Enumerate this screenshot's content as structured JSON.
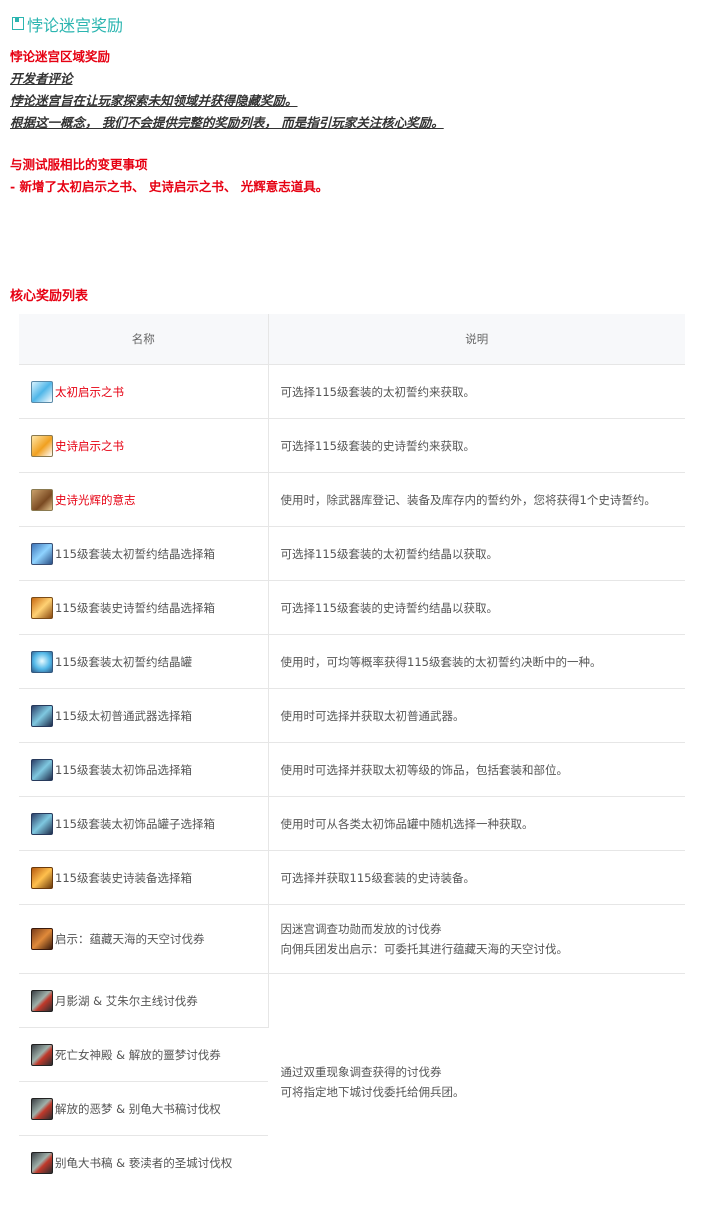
{
  "header": {
    "title": "悖论迷宫奖励"
  },
  "intro": {
    "zone_title": "悖论迷宫区域奖励",
    "dev_comment": "开发者评论",
    "line1": "悖论迷宫旨在让玩家探索未知领域并获得隐藏奖励。",
    "line2": "根据这一概念， 我们不会提供完整的奖励列表， 而是指引玩家关注核心奖励。",
    "changes_title": "与测试服相比的变更事项",
    "changes_line": "- 新增了太初启示之书、 史诗启示之书、 光辉意志道具。"
  },
  "section": {
    "title": "核心奖励列表"
  },
  "table": {
    "headers": [
      "名称",
      "说明"
    ],
    "rows": [
      {
        "name": "太初启示之书",
        "icon": "primeval-book-icon",
        "desc": "可选择115级套装的太初誓约来获取。",
        "red": true
      },
      {
        "name": "史诗启示之书",
        "icon": "epic-book-icon",
        "desc": "可选择115级套装的史诗誓约来获取。",
        "red": true
      },
      {
        "name": "史诗光辉的意志",
        "icon": "radiant-will-icon",
        "desc": "使用时，除武器库登记、装备及库存内的誓约外，您将获得1个史诗誓约。",
        "red": true
      },
      {
        "name": "115级套装太初誓约结晶选择箱",
        "icon": "primeval-crystal-box-icon",
        "desc": "可选择115级套装的太初誓约结晶以获取。",
        "red": false
      },
      {
        "name": "115级套装史诗誓约结晶选择箱",
        "icon": "epic-crystal-box-icon",
        "desc": "可选择115级套装的史诗誓约结晶以获取。",
        "red": false
      },
      {
        "name": "115级套装太初誓约结晶罐",
        "icon": "primeval-crystal-jar-icon",
        "desc": "使用时，可均等概率获得115级套装的太初誓约决断中的一种。",
        "red": false
      },
      {
        "name": "115级太初普通武器选择箱",
        "icon": "primeval-weapon-box-icon",
        "desc": "使用时可选择并获取太初普通武器。",
        "red": false
      },
      {
        "name": "115级套装太初饰品选择箱",
        "icon": "primeval-accessory-box-icon",
        "desc": "使用时可选择并获取太初等级的饰品，包括套装和部位。",
        "red": false
      },
      {
        "name": "115级套装太初饰品罐子选择箱",
        "icon": "primeval-accessory-jar-box-icon",
        "desc": "使用时可从各类太初饰品罐中随机选择一种获取。",
        "red": false
      },
      {
        "name": "115级套装史诗装备选择箱",
        "icon": "epic-equipment-box-icon",
        "desc": "可选择并获取115级套装的史诗装备。",
        "red": false
      }
    ],
    "skyhunt": {
      "name": "启示：蕴藏天海的天空讨伐券",
      "icon": "sky-raid-ticket-icon",
      "desc1": "因迷宫调查功勋而发放的讨伐券",
      "desc2": "向佣兵团发出启示：可委托其进行蕴藏天海的天空讨伐。"
    },
    "dungeon_group": {
      "names": [
        "月影湖 & 艾朱尔主线讨伐券",
        "死亡女神殿 & 解放的噩梦讨伐券",
        "解放的恶梦 & 别龟大书稿讨伐权",
        "别龟大书稿 & 亵渎者的圣城讨伐权"
      ],
      "icon": "dungeon-raid-ticket-icon",
      "desc1": "通过双重现象调查获得的讨伐券",
      "desc2": "可将指定地下城讨伐委托给佣兵团。"
    }
  }
}
